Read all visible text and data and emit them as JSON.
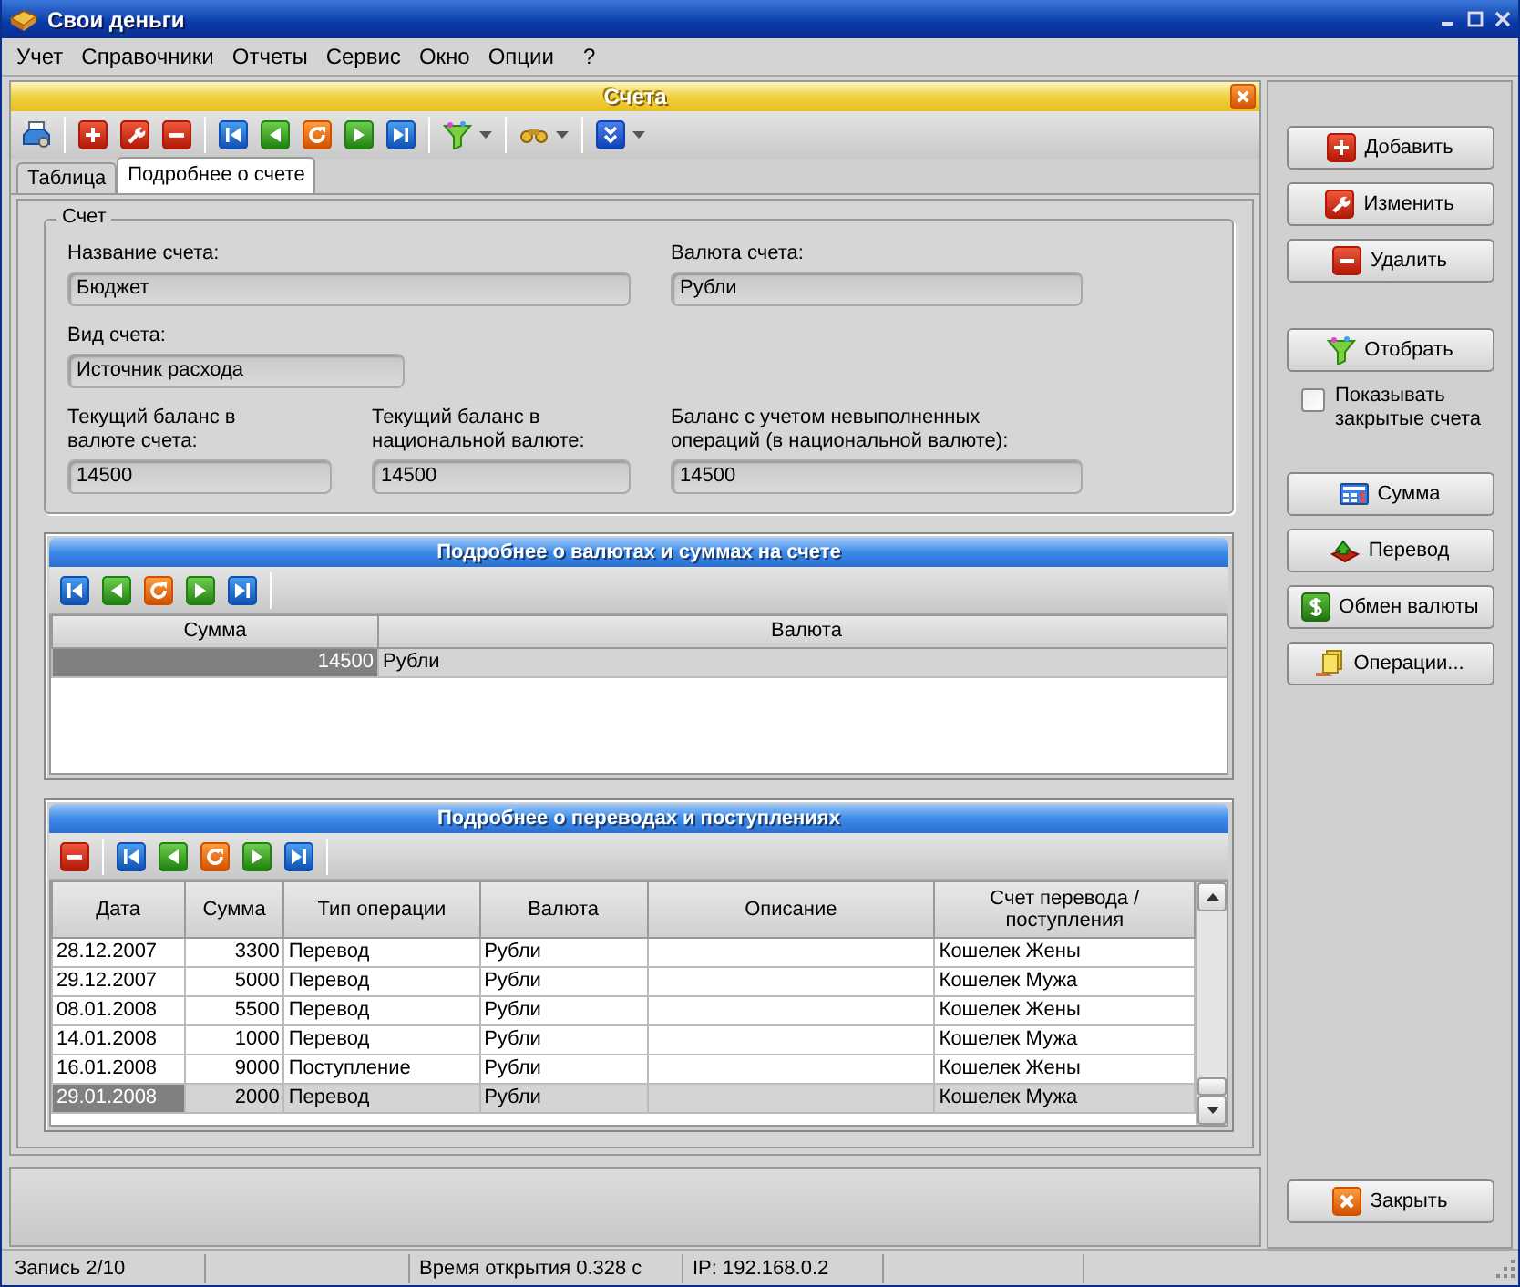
{
  "window": {
    "title": "Свои деньги"
  },
  "menu": [
    "Учет",
    "Справочники",
    "Отчеты",
    "Сервис",
    "Окно",
    "Опции",
    "?"
  ],
  "child_window": {
    "title": "Счета"
  },
  "tabs": [
    {
      "label": "Таблица",
      "selected": false
    },
    {
      "label": "Подробнее о счете",
      "selected": true
    }
  ],
  "account_group": {
    "legend": "Счет",
    "fields": [
      {
        "label": "Название счета:",
        "value": "Бюджет"
      },
      {
        "label": "Валюта счета:",
        "value": "Рубли"
      },
      {
        "label": "Вид счета:",
        "value": "Источник расхода"
      },
      {
        "label": "Текущий баланс в валюте счета:",
        "value": "14500"
      },
      {
        "label": "Текущий баланс в национальной валюте:",
        "value": "14500"
      },
      {
        "label": "Баланс с учетом невыполненных операций (в национальной валюте):",
        "value": "14500"
      }
    ]
  },
  "currency_panel": {
    "title": "Подробнее о валютах и суммах на счете",
    "columns": [
      "Сумма",
      "Валюта"
    ],
    "rows": [
      {
        "amount": "14500",
        "currency": "Рубли",
        "selected": true
      }
    ]
  },
  "transfers_panel": {
    "title": "Подробнее о переводах и поступлениях",
    "columns": [
      "Дата",
      "Сумма",
      "Тип операции",
      "Валюта",
      "Описание",
      "Счет перевода / поступления"
    ],
    "rows": [
      {
        "date": "28.12.2007",
        "amount": "3300",
        "type": "Перевод",
        "currency": "Рубли",
        "account": "Кошелек Жены",
        "selected": false
      },
      {
        "date": "29.12.2007",
        "amount": "5000",
        "type": "Перевод",
        "currency": "Рубли",
        "account": "Кошелек Мужа",
        "selected": false
      },
      {
        "date": "08.01.2008",
        "amount": "5500",
        "type": "Перевод",
        "currency": "Рубли",
        "account": "Кошелек Жены",
        "selected": false
      },
      {
        "date": "14.01.2008",
        "amount": "1000",
        "type": "Перевод",
        "currency": "Рубли",
        "account": "Кошелек Мужа",
        "selected": false
      },
      {
        "date": "16.01.2008",
        "amount": "9000",
        "type": "Поступление",
        "currency": "Рубли",
        "account": "Кошелек Жены",
        "selected": false
      },
      {
        "date": "29.01.2008",
        "amount": "2000",
        "type": "Перевод",
        "currency": "Рубли",
        "account": "Кошелек Мужа",
        "selected": true
      }
    ]
  },
  "side_buttons": [
    "Добавить",
    "Изменить",
    "Удалить",
    "Отобрать"
  ],
  "show_closed": {
    "label": "Показывать закрытые счета",
    "checked": false
  },
  "report_buttons": [
    "Сумма",
    "Перевод",
    "Обмен валюты",
    "Операции..."
  ],
  "close_button": "Закрыть",
  "status_bar": [
    "Запись 2/10",
    "Время открытия 0.328 с",
    "IP: 192.168.0.2"
  ]
}
